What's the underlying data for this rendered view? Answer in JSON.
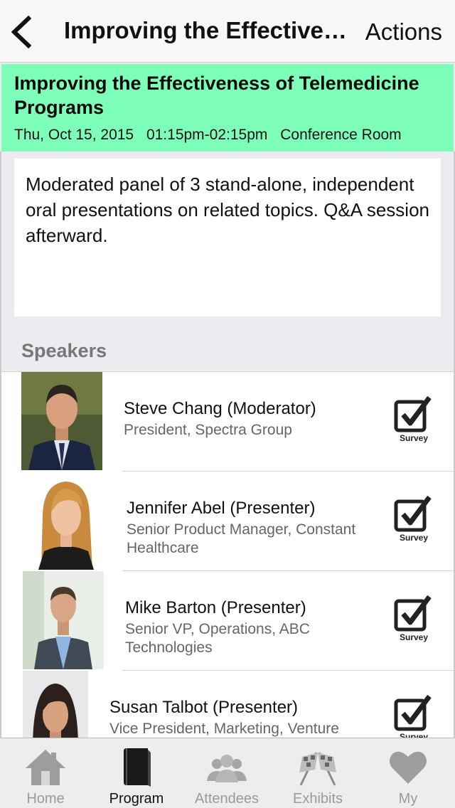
{
  "nav": {
    "title": "Improving the Effectiveness of Telemedicine Programs",
    "actions_label": "Actions"
  },
  "session": {
    "title": "Improving the Effectiveness of Telemedicine Programs",
    "date": "Thu, Oct 15, 2015",
    "time": "01:15pm-02:15pm",
    "location": "Conference Room",
    "description": "Moderated panel of 3 stand-alone, independent oral presentations on related topics. Q&A session afterward."
  },
  "speakers_heading": "Speakers",
  "speakers": [
    {
      "name": "Steve Chang (Moderator)",
      "role": "President, Spectra Group",
      "survey_label": "Survey"
    },
    {
      "name": "Jennifer Abel (Presenter)",
      "role": "Senior Product Manager, Constant Healthcare",
      "survey_label": "Survey"
    },
    {
      "name": "Mike Barton (Presenter)",
      "role": "Senior VP, Operations, ABC Technologies",
      "survey_label": "Survey"
    },
    {
      "name": "Susan Talbot (Presenter)",
      "role": "Vice President, Marketing, Venture",
      "survey_label": "Survey"
    }
  ],
  "tabs": [
    {
      "label": "Home",
      "icon": "home-icon",
      "active": false
    },
    {
      "label": "Program",
      "icon": "book-icon",
      "active": true
    },
    {
      "label": "Attendees",
      "icon": "people-icon",
      "active": false
    },
    {
      "label": "Exhibits",
      "icon": "checkered-flags-icon",
      "active": false
    },
    {
      "label": "My",
      "icon": "heart-icon",
      "active": false
    }
  ],
  "colors": {
    "session_header_bg": "#7effb9",
    "tab_inactive": "#9a9a9a",
    "tab_active": "#111111"
  }
}
